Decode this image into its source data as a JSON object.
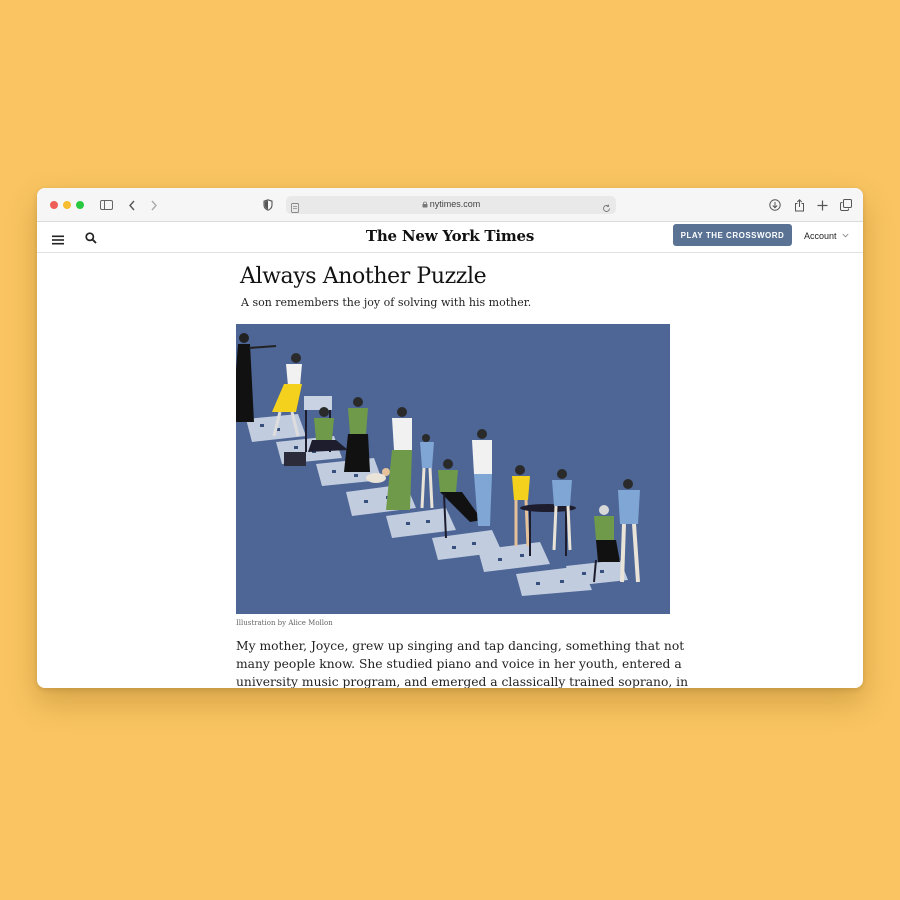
{
  "browser": {
    "url": "nytimes.com",
    "traffic_lights": [
      "#ee5f57",
      "#f5bd2f",
      "#28c840"
    ]
  },
  "navbar": {
    "logo": "The New York Times",
    "crossword_button": "PLAY THE CROSSWORD",
    "account_label": "Account"
  },
  "article": {
    "headline": "Always Another Puzzle",
    "dek": "A son remembers the joy of solving with his mother.",
    "caption": "Illustration by Alice Mollon",
    "body_lines": [
      "My mother, Joyce, grew up singing and tap dancing, something that not",
      "many people know. She studied piano and voice in her youth, entered a",
      "university music program, and emerged a classically trained soprano, in"
    ]
  },
  "colors": {
    "background": "#f9c461",
    "illustration_bg": "#4d6696",
    "button": "#5a7395"
  }
}
